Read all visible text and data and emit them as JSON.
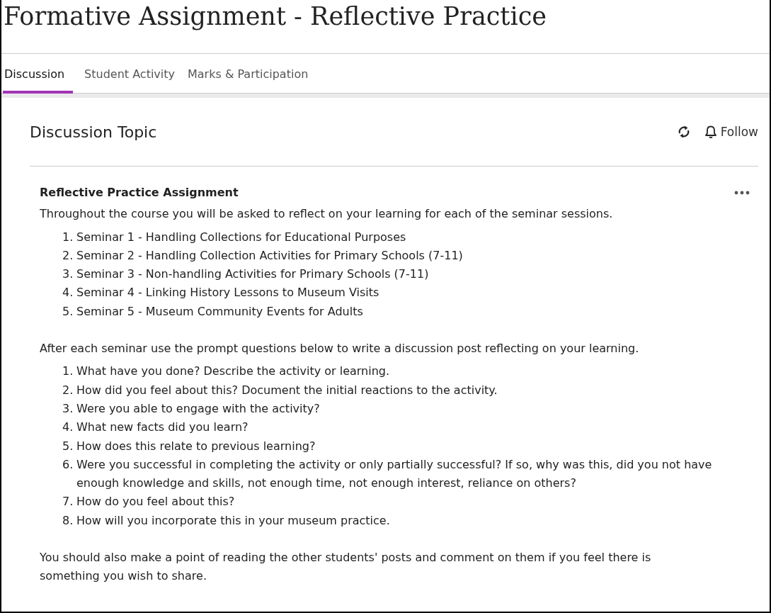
{
  "page_title": "Formative Assignment - Reflective Practice",
  "tabs": [
    {
      "label": "Discussion",
      "selected": true
    },
    {
      "label": "Student Activity",
      "selected": false
    },
    {
      "label": "Marks & Participation",
      "selected": false
    }
  ],
  "topic": {
    "heading": "Discussion Topic",
    "follow_label": "Follow",
    "post": {
      "title": "Reflective Practice Assignment",
      "blocks": [
        {
          "kind": "paragraph",
          "text": "Throughout the course you will be asked to reflect on your learning for each of the seminar sessions."
        },
        {
          "kind": "list",
          "items": [
            {
              "number": "1.",
              "text": "Seminar 1 - Handling Collections for Educational Purposes"
            },
            {
              "number": "2.",
              "text": "Seminar 2 - Handling Collection Activities for Primary Schools (7-11)"
            },
            {
              "number": "3.",
              "text": "Seminar 3 - Non-handling Activities for Primary Schools (7-11)"
            },
            {
              "number": "4.",
              "text": "Seminar 4 - Linking History Lessons to Museum Visits"
            },
            {
              "number": "5.",
              "text": "Seminar 5 - Museum Community Events for Adults"
            }
          ]
        },
        {
          "kind": "paragraph",
          "text": "After each seminar use the prompt questions below to write a discussion post reflecting on your learning."
        },
        {
          "kind": "list",
          "items": [
            {
              "number": "1.",
              "text": "What have you done? Describe the activity or learning."
            },
            {
              "number": "2.",
              "text": "How did you feel about this? Document the initial reactions to the activity."
            },
            {
              "number": "3.",
              "text": "Were you able to engage with the activity?"
            },
            {
              "number": "4.",
              "text": "What new facts did you learn?"
            },
            {
              "number": "5.",
              "text": "How does this relate to previous learning?"
            },
            {
              "number": "6.",
              "text": "Were you successful in completing the activity or only partially successful? If so, why was this, did you not have enough knowledge and skills, not enough time, not enough interest, reliance on others?"
            },
            {
              "number": "7.",
              "text": "How do you feel about this?"
            },
            {
              "number": "8.",
              "text": "How will you incorporate this in your museum practice."
            }
          ]
        },
        {
          "kind": "paragraph",
          "text": "You should also make a point of reading the other students' posts and comment on them if you feel there is something you wish to share."
        }
      ]
    }
  }
}
